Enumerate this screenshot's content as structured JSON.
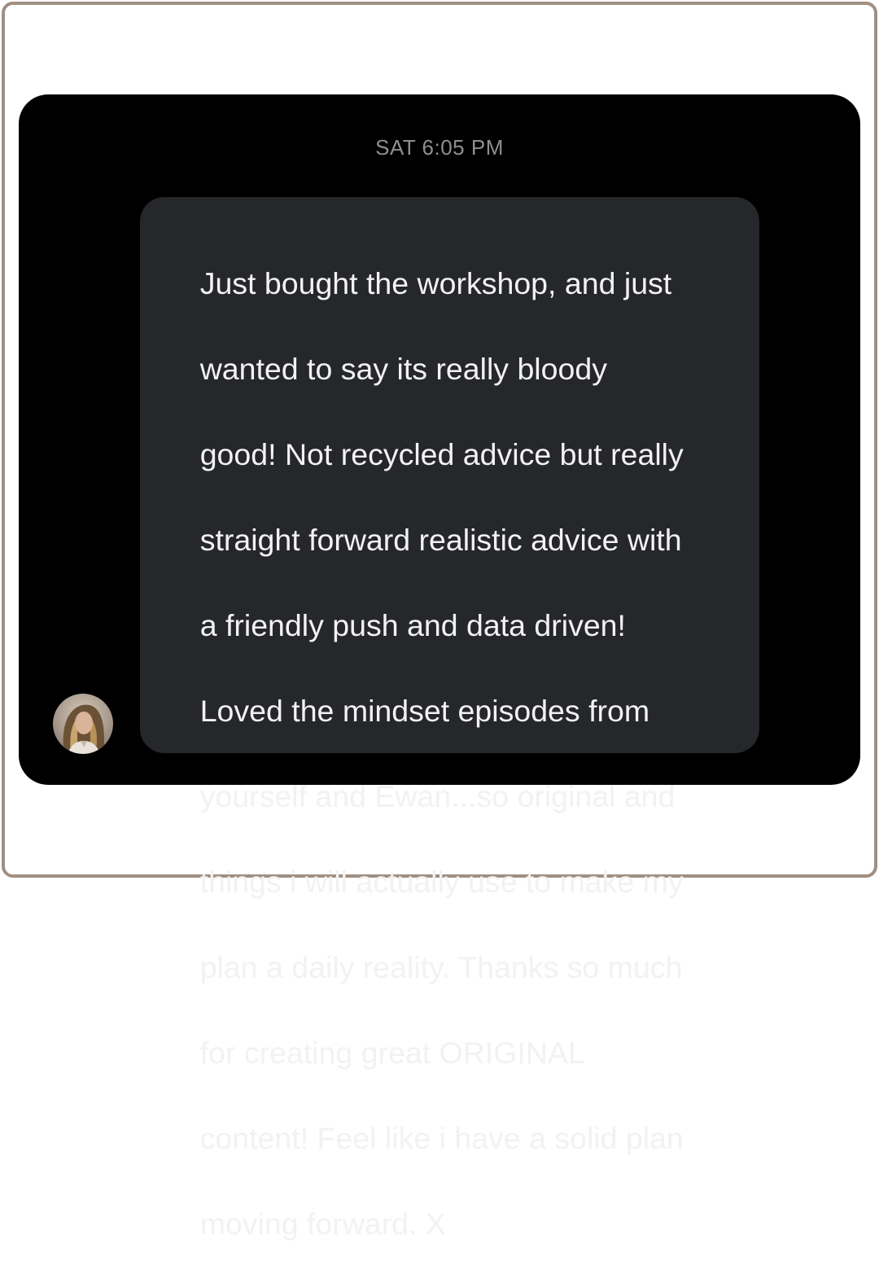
{
  "conversation": {
    "timestamp": "SAT 6:05 PM",
    "message": {
      "lines": [
        "Just bought the workshop, and just",
        "wanted to say its really bloody",
        "good! Not recycled advice but really",
        "straight forward realistic advice with",
        "a friendly push and data driven!",
        "Loved the mindset episodes from",
        "yourself and Ewan...so original and",
        "things i will actually use to make my",
        "plan a daily reality. Thanks so much",
        "for creating great ORIGINAL",
        "content! Feel like i have a solid plan",
        "moving forward. X"
      ]
    },
    "sender": {
      "avatar_icon": "profile-photo-avatar"
    }
  },
  "colors": {
    "frame_border": "#a08f82",
    "screen_background": "#000000",
    "bubble_background": "#26272b",
    "message_text": "#f2f2f2",
    "timestamp_text": "#8e8e93"
  }
}
